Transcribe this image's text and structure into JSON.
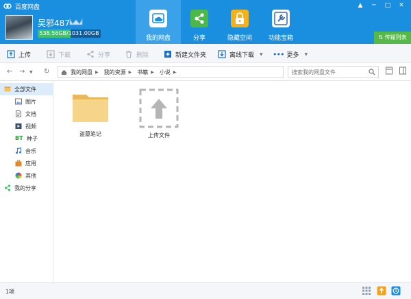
{
  "app": {
    "title": "百度网盘",
    "window_controls": [
      "▲",
      "─",
      "□",
      "✕"
    ]
  },
  "user": {
    "name": "吴邪487",
    "quota_text": "538.56GB/1031.00GB",
    "quota_used_fraction": 0.522
  },
  "nav": [
    {
      "label": "我的网盘",
      "icon": "cloud-drive-icon",
      "active": true
    },
    {
      "label": "分享",
      "icon": "share-icon"
    },
    {
      "label": "隐藏空间",
      "icon": "lock-icon"
    },
    {
      "label": "功能宝箱",
      "icon": "toolbox-icon"
    }
  ],
  "transfer_list": "传输列表",
  "toolbar": {
    "upload": "上传",
    "download": "下载",
    "share": "分享",
    "delete": "删除",
    "new_folder": "新建文件夹",
    "offline_download": "离线下载",
    "more": "更多"
  },
  "breadcrumb": [
    "我的网盘",
    "我的资源",
    "书籍",
    "小说"
  ],
  "search": {
    "placeholder": "搜索我的网盘文件"
  },
  "sidebar": [
    "全部文件",
    "图片",
    "文档",
    "视频",
    "种子",
    "音乐",
    "应用",
    "其他",
    "我的分享"
  ],
  "files": [
    {
      "name": "盗墓笔记",
      "type": "folder"
    }
  ],
  "upload_tile": "上传文件",
  "status": {
    "count": "1项"
  },
  "colors": {
    "header": "#1a8fe0",
    "active_tab": "#3ba2ea",
    "transfer": "#54b948",
    "folder": "#f6d48a"
  }
}
